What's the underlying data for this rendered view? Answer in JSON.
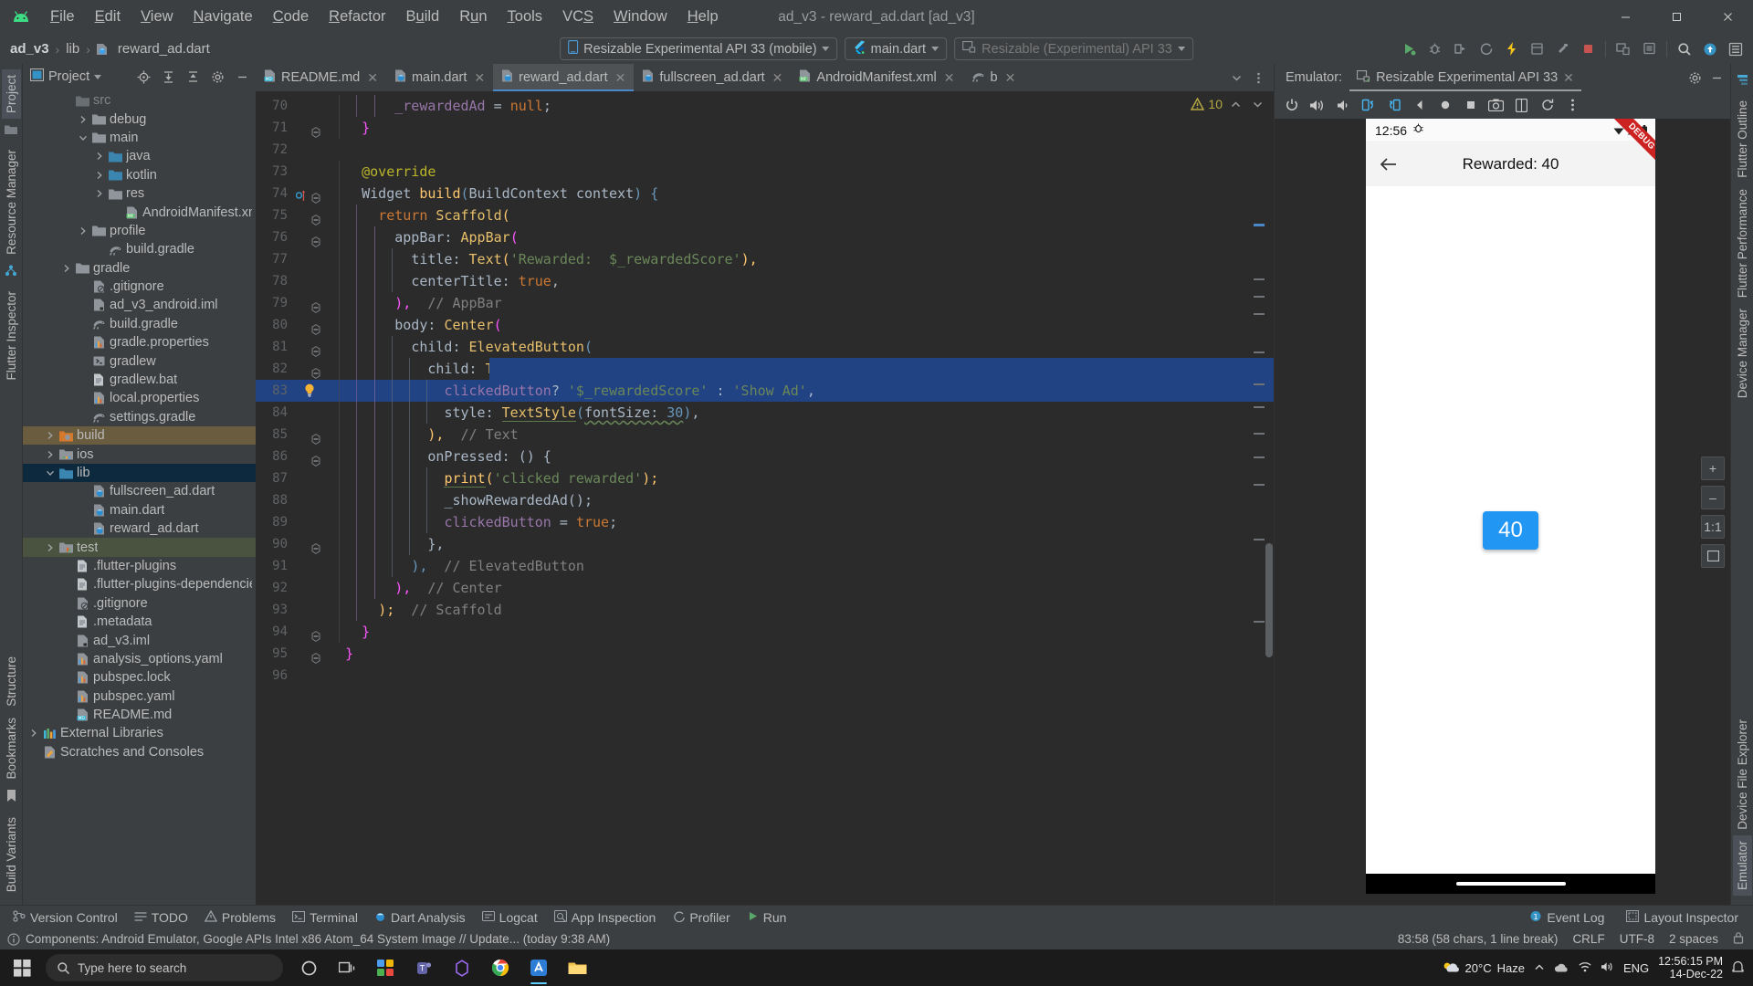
{
  "window": {
    "title": "ad_v3 - reward_ad.dart [ad_v3]",
    "minimize": "–",
    "maximize": "▢",
    "close": "✕"
  },
  "menu": {
    "items": [
      "File",
      "Edit",
      "View",
      "Navigate",
      "Code",
      "Refactor",
      "Build",
      "Run",
      "Tools",
      "VCS",
      "Window",
      "Help"
    ]
  },
  "breadcrumb": {
    "project": "ad_v3",
    "folder": "lib",
    "file": "reward_ad.dart",
    "sep": "›"
  },
  "toolbar": {
    "device_selector": "Resizable Experimental API 33 (mobile)",
    "run_config": "main.dart",
    "device_secondary": "Resizable (Experimental) API 33",
    "run_title": "Run",
    "debug_title": "Debug",
    "profile_title": "Profile",
    "coverage_title": "Run with Coverage",
    "hot_reload_title": "Hot Reload",
    "attach_title": "Attach Debugger",
    "stop_title": "Stop",
    "device_manager_title": "Device Manager",
    "search_title": "Search Everywhere",
    "updates_title": "Updates",
    "settings_title": "Settings"
  },
  "sidebar_left": {
    "tabs": [
      "Project",
      "Resource Manager"
    ],
    "bottom_tabs": [
      "Structure",
      "Bookmarks",
      "Build Variants"
    ],
    "active_tab": "Project"
  },
  "sidebar_right": {
    "tabs": [
      "Flutter Outline",
      "Flutter Performance",
      "Device Manager",
      "Device File Explorer",
      "Emulator"
    ],
    "left_icon_tab": "Flutter Inspector"
  },
  "project_panel": {
    "title": "Project",
    "tree": [
      {
        "label": "src",
        "indent": 3,
        "twist": "",
        "icon": "folder-gray",
        "partial": true
      },
      {
        "label": "debug",
        "indent": 4,
        "twist": "right",
        "icon": "folder-gray"
      },
      {
        "label": "main",
        "indent": 4,
        "twist": "down",
        "icon": "folder-gray"
      },
      {
        "label": "java",
        "indent": 5,
        "twist": "right",
        "icon": "folder-blue"
      },
      {
        "label": "kotlin",
        "indent": 5,
        "twist": "right",
        "icon": "folder-blue"
      },
      {
        "label": "res",
        "indent": 5,
        "twist": "right",
        "icon": "folder-gray"
      },
      {
        "label": "AndroidManifest.xml",
        "indent": 6,
        "twist": "",
        "icon": "file-manifest"
      },
      {
        "label": "profile",
        "indent": 4,
        "twist": "right",
        "icon": "folder-gray"
      },
      {
        "label": "build.gradle",
        "indent": 5,
        "twist": "",
        "icon": "file-gradle"
      },
      {
        "label": "gradle",
        "indent": 3,
        "twist": "right",
        "icon": "folder-gray"
      },
      {
        "label": ".gitignore",
        "indent": 4,
        "twist": "",
        "icon": "file-gitignore"
      },
      {
        "label": "ad_v3_android.iml",
        "indent": 4,
        "twist": "",
        "icon": "file-iml"
      },
      {
        "label": "build.gradle",
        "indent": 4,
        "twist": "",
        "icon": "file-gradle"
      },
      {
        "label": "gradle.properties",
        "indent": 4,
        "twist": "",
        "icon": "file-properties"
      },
      {
        "label": "gradlew",
        "indent": 4,
        "twist": "",
        "icon": "file-script"
      },
      {
        "label": "gradlew.bat",
        "indent": 4,
        "twist": "",
        "icon": "file-text"
      },
      {
        "label": "local.properties",
        "indent": 4,
        "twist": "",
        "icon": "file-properties"
      },
      {
        "label": "settings.gradle",
        "indent": 4,
        "twist": "",
        "icon": "file-gradle"
      },
      {
        "label": "build",
        "indent": 2,
        "twist": "right",
        "icon": "folder-build",
        "state": "sel-build"
      },
      {
        "label": "ios",
        "indent": 2,
        "twist": "right",
        "icon": "folder-ios"
      },
      {
        "label": "lib",
        "indent": 2,
        "twist": "down",
        "icon": "folder-blue",
        "state": "sel-lib"
      },
      {
        "label": "fullscreen_ad.dart",
        "indent": 4,
        "twist": "",
        "icon": "file-dart"
      },
      {
        "label": "main.dart",
        "indent": 4,
        "twist": "",
        "icon": "file-dart"
      },
      {
        "label": "reward_ad.dart",
        "indent": 4,
        "twist": "",
        "icon": "file-dart"
      },
      {
        "label": "test",
        "indent": 2,
        "twist": "right",
        "icon": "folder-test",
        "state": "sel-test"
      },
      {
        "label": ".flutter-plugins",
        "indent": 3,
        "twist": "",
        "icon": "file-text"
      },
      {
        "label": ".flutter-plugins-dependencies",
        "indent": 3,
        "twist": "",
        "icon": "file-text"
      },
      {
        "label": ".gitignore",
        "indent": 3,
        "twist": "",
        "icon": "file-gitignore"
      },
      {
        "label": ".metadata",
        "indent": 3,
        "twist": "",
        "icon": "file-text"
      },
      {
        "label": "ad_v3.iml",
        "indent": 3,
        "twist": "",
        "icon": "file-iml"
      },
      {
        "label": "analysis_options.yaml",
        "indent": 3,
        "twist": "",
        "icon": "file-yaml"
      },
      {
        "label": "pubspec.lock",
        "indent": 3,
        "twist": "",
        "icon": "file-yaml"
      },
      {
        "label": "pubspec.yaml",
        "indent": 3,
        "twist": "",
        "icon": "file-yaml"
      },
      {
        "label": "README.md",
        "indent": 3,
        "twist": "",
        "icon": "file-md"
      },
      {
        "label": "External Libraries",
        "indent": 1,
        "twist": "right",
        "icon": "libs"
      },
      {
        "label": "Scratches and Consoles",
        "indent": 1,
        "twist": "",
        "icon": "scratch"
      }
    ]
  },
  "editor": {
    "tabs": [
      {
        "label": "README.md",
        "icon": "file-md",
        "active": false
      },
      {
        "label": "main.dart",
        "icon": "file-dart",
        "active": false
      },
      {
        "label": "reward_ad.dart",
        "icon": "file-dart",
        "active": true
      },
      {
        "label": "fullscreen_ad.dart",
        "icon": "file-dart",
        "active": false
      },
      {
        "label": "AndroidManifest.xml",
        "icon": "file-manifest",
        "active": false
      },
      {
        "label": "b",
        "icon": "file-gradle",
        "active": false
      }
    ],
    "warning_count": "10",
    "first_line": 70,
    "lines": [
      {
        "n": 70,
        "indent": 4,
        "fold": "",
        "tokens": [
          {
            "t": "_rewardedAd ",
            "c": "fld"
          },
          {
            "t": "= ",
            "c": "plain"
          },
          {
            "t": "null",
            "c": "kw"
          },
          {
            "t": ";",
            "c": "plain"
          }
        ]
      },
      {
        "n": 71,
        "indent": 2,
        "fold": "minus",
        "tokens": [
          {
            "t": "}",
            "c": "paren-p"
          }
        ]
      },
      {
        "n": 72,
        "indent": 0,
        "fold": "",
        "tokens": []
      },
      {
        "n": 73,
        "indent": 2,
        "fold": "",
        "tokens": [
          {
            "t": "@override",
            "c": "ann"
          }
        ]
      },
      {
        "n": 74,
        "indent": 2,
        "fold": "minus",
        "gutter": "override",
        "tokens": [
          {
            "t": "Widget ",
            "c": "plain"
          },
          {
            "t": "build",
            "c": "fn"
          },
          {
            "t": "(",
            "c": "paren-b"
          },
          {
            "t": "BuildContext ",
            "c": "plain"
          },
          {
            "t": "context",
            "c": "plain"
          },
          {
            "t": ") {",
            "c": "paren-b"
          }
        ]
      },
      {
        "n": 75,
        "indent": 3,
        "fold": "minus",
        "tokens": [
          {
            "t": "return ",
            "c": "kw"
          },
          {
            "t": "Scaffold",
            "c": "cls"
          },
          {
            "t": "(",
            "c": "paren-o"
          }
        ]
      },
      {
        "n": 76,
        "indent": 4,
        "fold": "minus",
        "tokens": [
          {
            "t": "appBar: ",
            "c": "plain"
          },
          {
            "t": "AppBar",
            "c": "cls"
          },
          {
            "t": "(",
            "c": "paren-p"
          }
        ]
      },
      {
        "n": 77,
        "indent": 5,
        "fold": "",
        "tokens": [
          {
            "t": "title: ",
            "c": "plain"
          },
          {
            "t": "Text",
            "c": "cls"
          },
          {
            "t": "(",
            "c": "paren-o"
          },
          {
            "t": "'Rewarded:  $_rewardedScore'",
            "c": "str"
          },
          {
            "t": "),",
            "c": "paren-o"
          }
        ]
      },
      {
        "n": 78,
        "indent": 5,
        "fold": "",
        "tokens": [
          {
            "t": "centerTitle: ",
            "c": "plain"
          },
          {
            "t": "true",
            "c": "kw"
          },
          {
            "t": ",",
            "c": "plain"
          }
        ]
      },
      {
        "n": 79,
        "indent": 4,
        "fold": "minus",
        "tokens": [
          {
            "t": "),",
            "c": "paren-p"
          },
          {
            "t": "  // AppBar",
            "c": "cmt"
          }
        ]
      },
      {
        "n": 80,
        "indent": 4,
        "fold": "minus",
        "tokens": [
          {
            "t": "body: ",
            "c": "plain"
          },
          {
            "t": "Center",
            "c": "cls"
          },
          {
            "t": "(",
            "c": "paren-p"
          }
        ]
      },
      {
        "n": 81,
        "indent": 5,
        "fold": "minus",
        "tokens": [
          {
            "t": "child: ",
            "c": "plain"
          },
          {
            "t": "ElevatedButton",
            "c": "cls"
          },
          {
            "t": "(",
            "c": "paren-b"
          }
        ]
      },
      {
        "n": 82,
        "indent": 6,
        "fold": "minus",
        "highlight_partial": true,
        "tokens": [
          {
            "t": "child: ",
            "c": "plain"
          },
          {
            "t": "Text",
            "c": "cls"
          },
          {
            "t": "(",
            "c": "paren-o"
          }
        ]
      },
      {
        "n": 83,
        "indent": 7,
        "fold": "",
        "bulb": true,
        "highlight": true,
        "tokens": [
          {
            "t": "clickedButton",
            "c": "fld"
          },
          {
            "t": "? ",
            "c": "plain"
          },
          {
            "t": "'$_rewardedScore'",
            "c": "str"
          },
          {
            "t": " : ",
            "c": "plain"
          },
          {
            "t": "'Show Ad'",
            "c": "str"
          },
          {
            "t": ",",
            "c": "plain"
          }
        ]
      },
      {
        "n": 84,
        "indent": 7,
        "fold": "",
        "tokens": [
          {
            "t": "style: ",
            "c": "plain"
          },
          {
            "t": "TextStyle",
            "c": "cls uline"
          },
          {
            "t": "(",
            "c": "paren-b"
          },
          {
            "t": "fontSize: ",
            "c": "plain wavy"
          },
          {
            "t": "30",
            "c": "num wavy"
          },
          {
            "t": ")",
            "c": "paren-b"
          },
          {
            "t": ",",
            "c": "plain"
          }
        ]
      },
      {
        "n": 85,
        "indent": 6,
        "fold": "minus",
        "tokens": [
          {
            "t": "),",
            "c": "paren-o"
          },
          {
            "t": "  // Text",
            "c": "cmt"
          }
        ]
      },
      {
        "n": 86,
        "indent": 6,
        "fold": "minus",
        "tokens": [
          {
            "t": "onPressed: () {",
            "c": "plain"
          }
        ]
      },
      {
        "n": 87,
        "indent": 7,
        "fold": "",
        "tokens": [
          {
            "t": "print",
            "c": "fn uline"
          },
          {
            "t": "(",
            "c": "paren-o"
          },
          {
            "t": "'clicked rewarded'",
            "c": "str"
          },
          {
            "t": ");",
            "c": "paren-o"
          }
        ]
      },
      {
        "n": 88,
        "indent": 7,
        "fold": "",
        "tokens": [
          {
            "t": "_showRewardedAd",
            "c": "plain"
          },
          {
            "t": "();",
            "c": "plain"
          }
        ]
      },
      {
        "n": 89,
        "indent": 7,
        "fold": "",
        "tokens": [
          {
            "t": "clickedButton ",
            "c": "fld"
          },
          {
            "t": "= ",
            "c": "plain"
          },
          {
            "t": "true",
            "c": "kw"
          },
          {
            "t": ";",
            "c": "plain"
          }
        ]
      },
      {
        "n": 90,
        "indent": 6,
        "fold": "minus",
        "tokens": [
          {
            "t": "},",
            "c": "plain"
          }
        ]
      },
      {
        "n": 91,
        "indent": 5,
        "fold": "",
        "tokens": [
          {
            "t": "),",
            "c": "paren-b"
          },
          {
            "t": "  // ElevatedButton",
            "c": "cmt"
          }
        ]
      },
      {
        "n": 92,
        "indent": 4,
        "fold": "",
        "tokens": [
          {
            "t": "),",
            "c": "paren-p"
          },
          {
            "t": "  // Center",
            "c": "cmt"
          }
        ]
      },
      {
        "n": 93,
        "indent": 3,
        "fold": "",
        "tokens": [
          {
            "t": ");",
            "c": "paren-o"
          },
          {
            "t": "  // Scaffold",
            "c": "cmt"
          }
        ]
      },
      {
        "n": 94,
        "indent": 2,
        "fold": "minus",
        "tokens": [
          {
            "t": "}",
            "c": "paren-p"
          }
        ]
      },
      {
        "n": 95,
        "indent": 1,
        "fold": "minus",
        "tokens": [
          {
            "t": "}",
            "c": "paren-p"
          }
        ]
      },
      {
        "n": 96,
        "indent": 0,
        "fold": "",
        "tokens": []
      }
    ]
  },
  "emulator": {
    "panel_label": "Emulator:",
    "tab_label": "Resizable Experimental API 33",
    "toolbar_icons": [
      "power-icon",
      "volume-up-icon",
      "volume-down-icon",
      "rotate-left-icon",
      "rotate-right-icon",
      "back-icon",
      "home-icon",
      "overview-icon",
      "screenshot-icon",
      "fold-icon",
      "restore-icon",
      "more-icon"
    ],
    "device": {
      "status_time": "12:56",
      "app_bar_title": "Rewarded:  40",
      "button_label": "40",
      "debug_ribbon": "DEBUG"
    },
    "zoom_controls": [
      "+",
      "–",
      "1:1",
      "fit"
    ]
  },
  "tool_windows": {
    "left_items": [
      {
        "label": "Version Control",
        "icon": "vcs-icon"
      },
      {
        "label": "TODO",
        "icon": "todo-icon"
      },
      {
        "label": "Problems",
        "icon": "problems-icon"
      },
      {
        "label": "Terminal",
        "icon": "terminal-icon"
      },
      {
        "label": "Dart Analysis",
        "icon": "dart-icon"
      },
      {
        "label": "Logcat",
        "icon": "logcat-icon"
      },
      {
        "label": "App Inspection",
        "icon": "inspection-icon"
      },
      {
        "label": "Profiler",
        "icon": "profiler-icon"
      },
      {
        "label": "Run",
        "icon": "run-icon"
      }
    ],
    "right_items": [
      {
        "label": "Event Log",
        "icon": "event-log-icon",
        "badge": "1"
      },
      {
        "label": "Layout Inspector",
        "icon": "layout-inspector-icon"
      }
    ]
  },
  "status_bar": {
    "message": "Components: Android Emulator, Google APIs Intel x86 Atom_64 System Image // Update... (today 9:38 AM)",
    "caret": "83:58 (58 chars, 1 line break)",
    "line_sep": "CRLF",
    "encoding": "UTF-8",
    "indent": "2 spaces"
  },
  "taskbar": {
    "search_placeholder": "Type here to search",
    "weather_temp": "20°C",
    "weather_desc": "Haze",
    "clock_time": "12:56:15 PM",
    "clock_date": "14-Dec-22",
    "lang": "ENG",
    "apps": [
      "task-view-icon",
      "widgets-icon",
      "teams-icon",
      "store-icon",
      "chrome-icon",
      "android-studio-icon",
      "file-explorer-icon"
    ]
  },
  "colors": {
    "accent_blue": "#4a88c7",
    "selection_blue": "#214283",
    "editor_bg": "#2b2b2b",
    "panel_bg": "#3c3f41",
    "flutter_blue": "#2196f3",
    "debug_red": "#cc2222"
  }
}
